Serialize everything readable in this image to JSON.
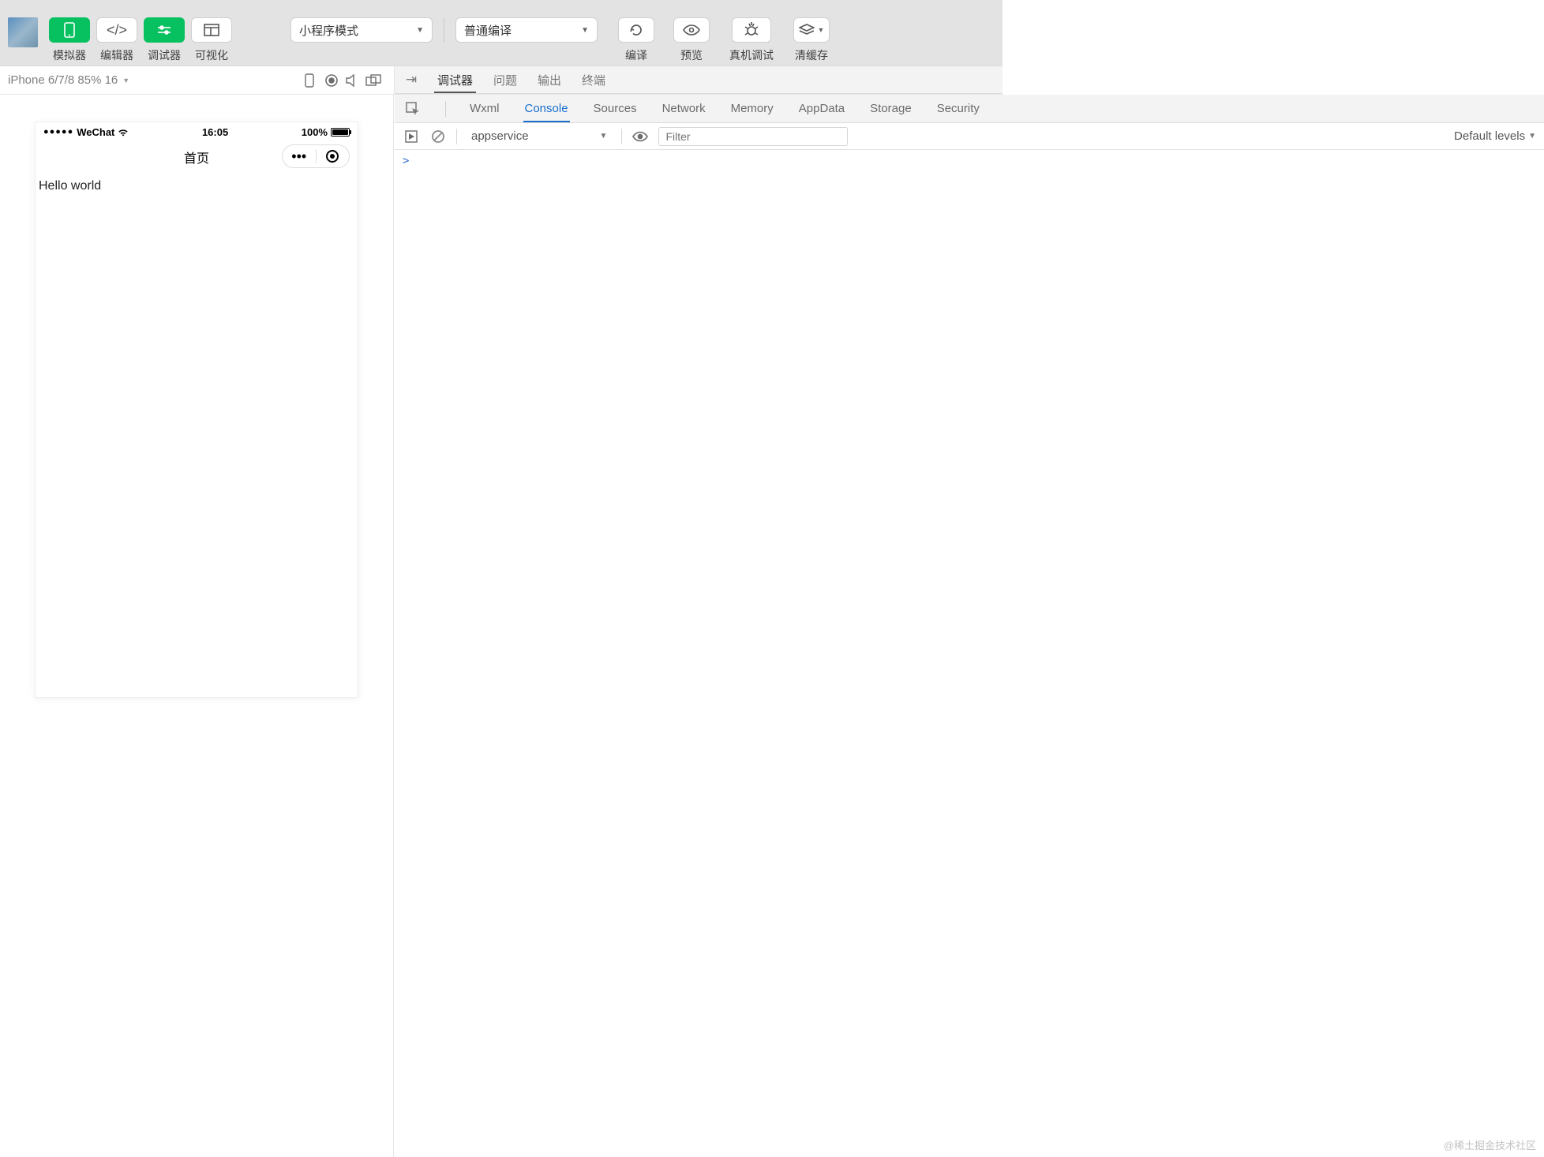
{
  "toolbar": {
    "cluster1": [
      {
        "label": "模拟器",
        "icon": "phone",
        "green": true
      },
      {
        "label": "编辑器",
        "icon": "code",
        "green": false
      },
      {
        "label": "调试器",
        "icon": "sliders",
        "green": true
      },
      {
        "label": "可视化",
        "icon": "layout",
        "green": false
      }
    ],
    "modeSelect": "小程序模式",
    "compileSelect": "普通编译",
    "cluster2": [
      {
        "label": "编译",
        "icon": "refresh"
      },
      {
        "label": "预览",
        "icon": "eye"
      },
      {
        "label": "真机调试",
        "icon": "bug"
      },
      {
        "label": "清缓存",
        "icon": "layers"
      }
    ]
  },
  "row2Left": {
    "device": "iPhone 6/7/8 85% 16"
  },
  "row2Right": {
    "tabs": [
      "调试器",
      "问题",
      "输出",
      "终端"
    ],
    "active": 0
  },
  "devtoolsTabs": {
    "tabs": [
      "Wxml",
      "Console",
      "Sources",
      "Network",
      "Memory",
      "AppData",
      "Storage",
      "Security"
    ],
    "active": 1
  },
  "console": {
    "context": "appservice",
    "filterPlaceholder": "Filter",
    "levels": "Default levels",
    "prompt": ">"
  },
  "sim": {
    "carrier": "WeChat",
    "time": "16:05",
    "battery": "100%",
    "title": "首页",
    "content": "Hello world"
  },
  "watermark": "@稀土掘金技术社区"
}
